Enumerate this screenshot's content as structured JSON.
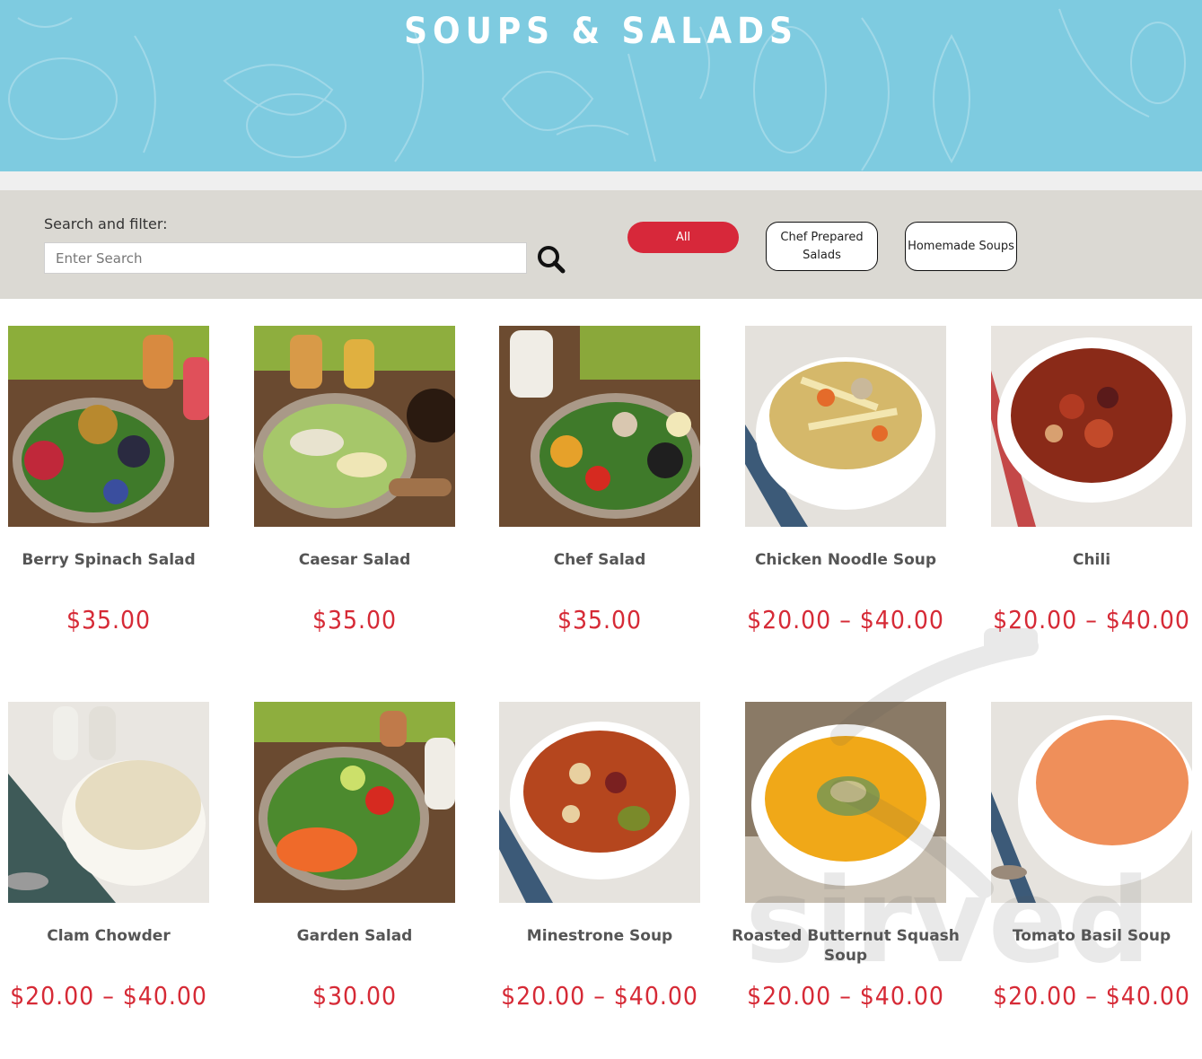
{
  "page": {
    "title": "SOUPS & SALADS"
  },
  "filter": {
    "label": "Search and filter:",
    "search_placeholder": "Enter Search",
    "search_icon": "magnifier-icon",
    "categories": [
      {
        "label": "All",
        "active": true
      },
      {
        "label": "Chef Prepared Salads",
        "active": false
      },
      {
        "label": "Homemade Soups",
        "active": false
      }
    ]
  },
  "products": [
    {
      "name": "Berry Spinach Salad",
      "price": "$35.00",
      "image": "salad-bowl-berries"
    },
    {
      "name": "Caesar Salad",
      "price": "$35.00",
      "image": "salad-bowl-caesar"
    },
    {
      "name": "Chef Salad",
      "price": "$35.00",
      "image": "salad-bowl-chef"
    },
    {
      "name": "Chicken Noodle Soup",
      "price": "$20.00 – $40.00",
      "image": "soup-bowl-chicken-noodle"
    },
    {
      "name": "Chili",
      "price": "$20.00 – $40.00",
      "image": "soup-bowl-chili"
    },
    {
      "name": "Clam Chowder",
      "price": "$20.00 – $40.00",
      "image": "soup-bowl-chowder"
    },
    {
      "name": "Garden Salad",
      "price": "$30.00",
      "image": "salad-bowl-garden"
    },
    {
      "name": "Minestrone Soup",
      "price": "$20.00 – $40.00",
      "image": "soup-bowl-minestrone"
    },
    {
      "name": "Roasted Butternut Squash Soup",
      "price": "$20.00 – $40.00",
      "image": "soup-bowl-butternut"
    },
    {
      "name": "Tomato Basil Soup",
      "price": "$20.00 – $40.00",
      "image": "soup-bowl-tomato"
    }
  ],
  "watermark": {
    "text": "sirved",
    "icon": "fork-icon"
  },
  "colors": {
    "hero_bg": "#7ecbe0",
    "filter_bg": "#dbd9d3",
    "accent_red": "#d7283a",
    "price_red": "#d62a36"
  }
}
